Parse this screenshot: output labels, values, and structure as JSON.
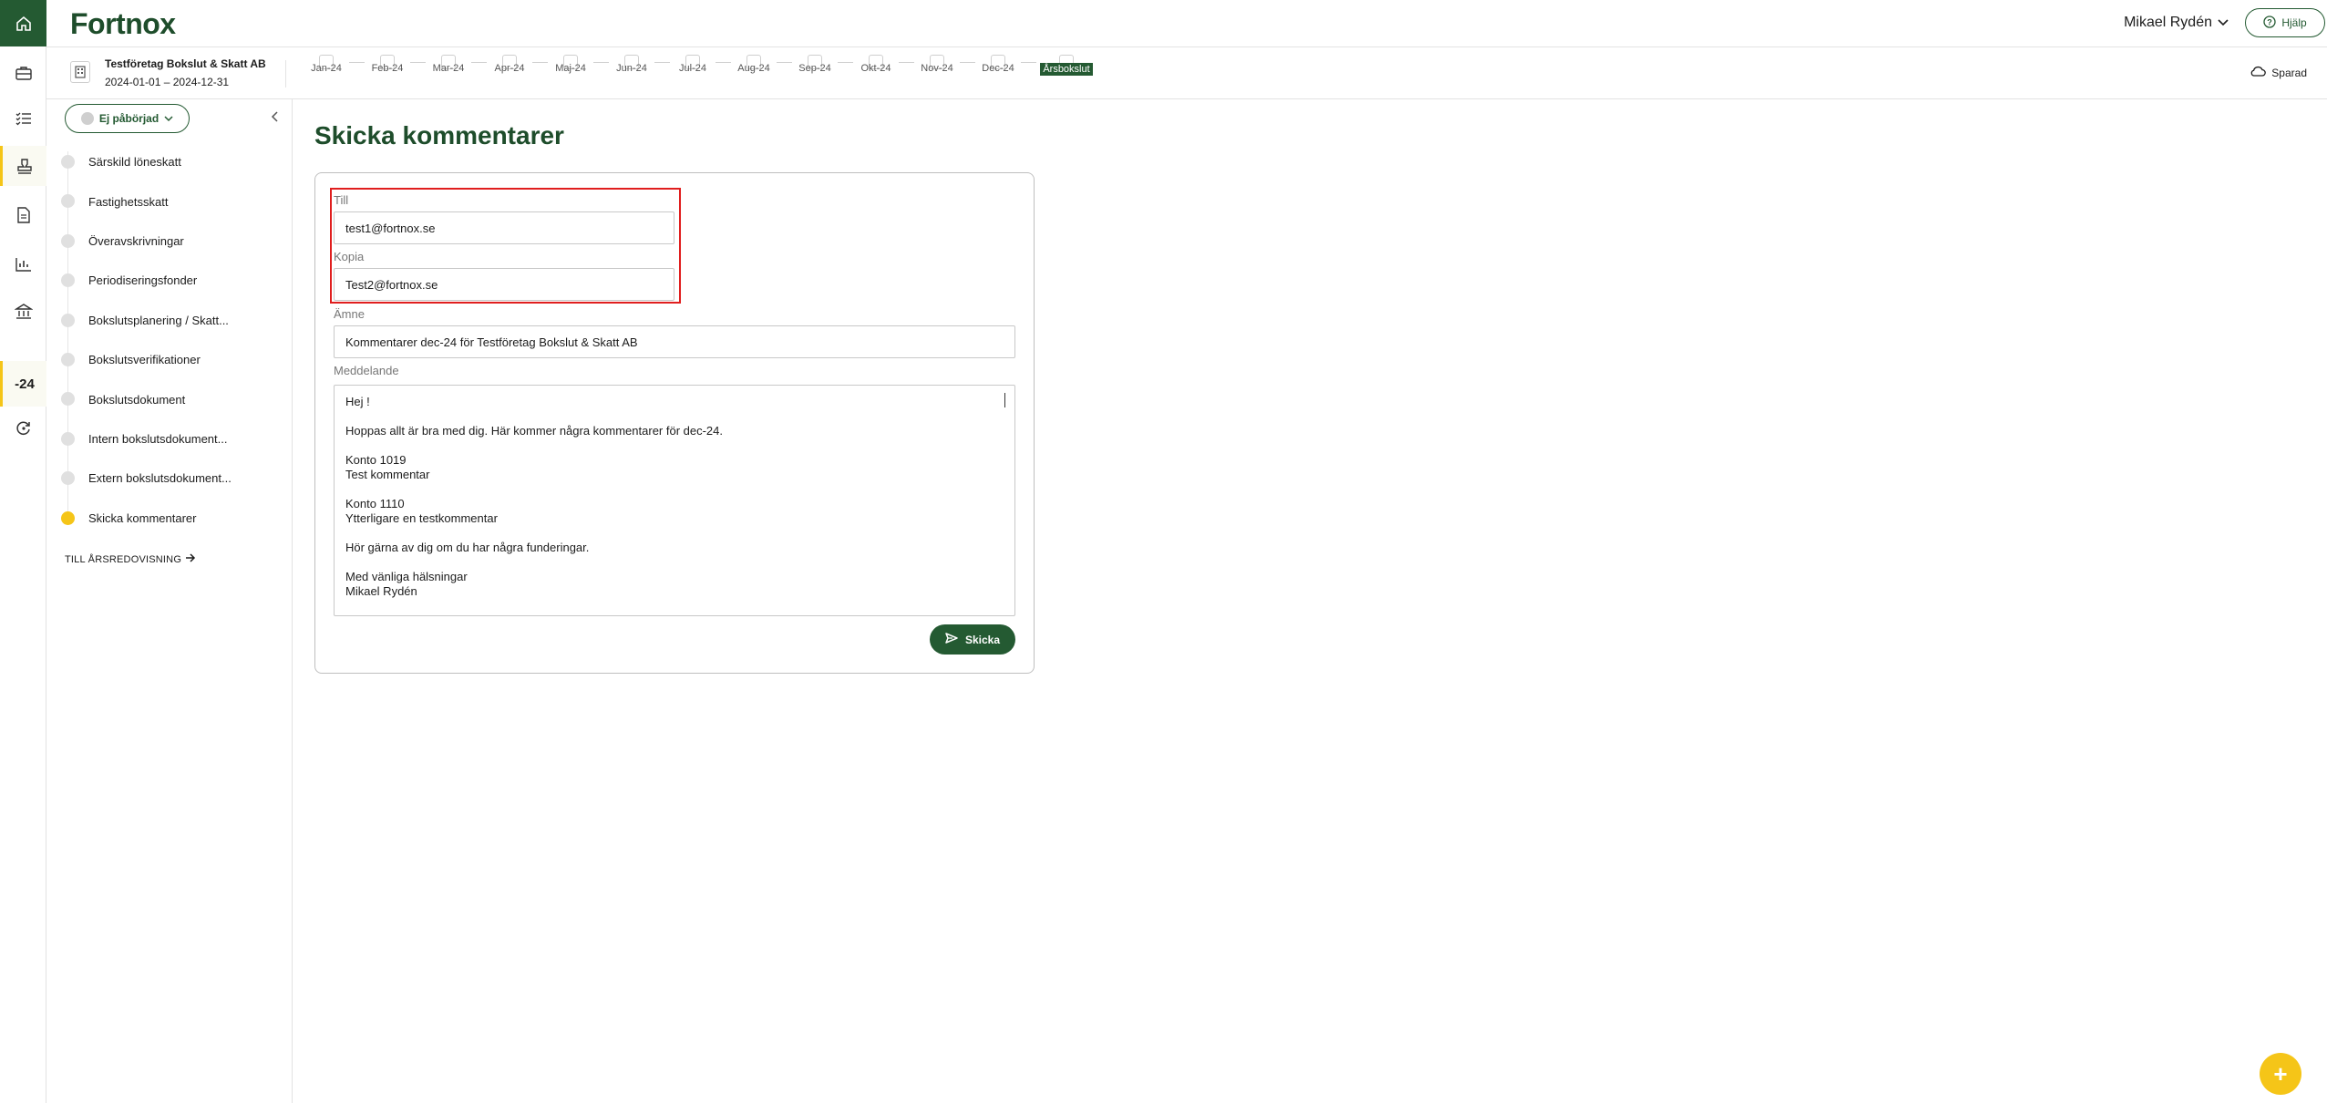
{
  "app": {
    "logo": "Fortnox",
    "brand_color": "#245a32",
    "accent_color": "#f5c518"
  },
  "header": {
    "user_name": "Mikael Rydén",
    "help_label": "Hjälp"
  },
  "company": {
    "name": "Testföretag Bokslut & Skatt AB",
    "period": "2024-01-01 – 2024-12-31"
  },
  "months": [
    "Jan-24",
    "Feb-24",
    "Mar-24",
    "Apr-24",
    "Maj-24",
    "Jun-24",
    "Jul-24",
    "Aug-24",
    "Sep-24",
    "Okt-24",
    "Nov-24",
    "Dec-24",
    "Årsbokslut"
  ],
  "saved_label": "Sparad",
  "rail": {
    "year_label": "-24"
  },
  "sidebar": {
    "status": "Ej påbörjad",
    "items": [
      "Särskild löneskatt",
      "Fastighetsskatt",
      "Överavskrivningar",
      "Periodiseringsfonder",
      "Bokslutsplanering / Skatt...",
      "Bokslutsverifikationer",
      "Bokslutsdokument",
      "Intern bokslutsdokument...",
      "Extern bokslutsdokument...",
      "Skicka kommentarer"
    ],
    "link": "TILL ÅRSREDOVISNING"
  },
  "page": {
    "title": "Skicka kommentarer"
  },
  "form": {
    "to_label": "Till",
    "to_value": "test1@fortnox.se",
    "cc_label": "Kopia",
    "cc_value": "Test2@fortnox.se",
    "subject_label": "Ämne",
    "subject_value": "Kommentarer dec-24 för Testföretag Bokslut & Skatt AB",
    "message_label": "Meddelande",
    "message": {
      "l1": "Hej !",
      "l2": "Hoppas allt är bra med dig. Här kommer några kommentarer för dec-24.",
      "l3": "Konto 1019",
      "l4": "Test kommentar",
      "l5": "Konto 1110",
      "l6": "Ytterligare en testkommentar",
      "l7": "Hör gärna av dig om du har några funderingar.",
      "l8": "Med vänliga hälsningar",
      "l9": "Mikael Rydén"
    },
    "send_label": "Skicka"
  }
}
